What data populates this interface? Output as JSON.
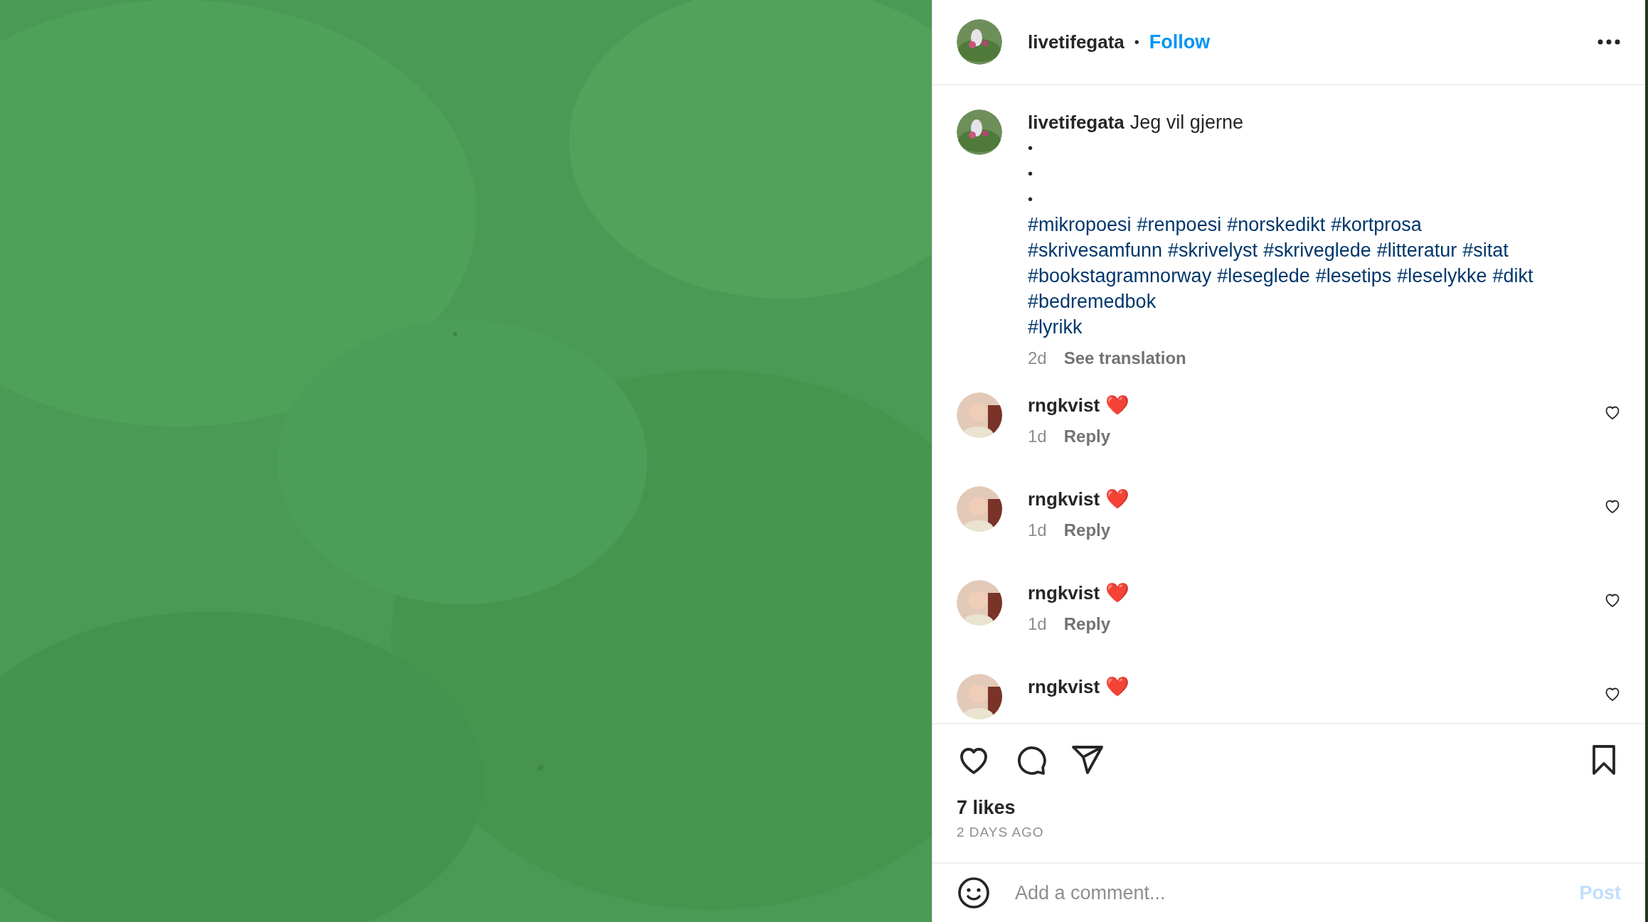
{
  "header": {
    "username": "livetifegata",
    "separator": "•",
    "follow": "Follow"
  },
  "caption": {
    "username": "livetifegata",
    "text": "Jeg vil gjerne",
    "bullets": [
      "•",
      "•",
      "•"
    ],
    "hashtag_lines": [
      [
        "#mikropoesi",
        "#renpoesi",
        "#norskedikt",
        "#kortprosa"
      ],
      [
        "#skrivesamfunn",
        "#skrivelyst",
        "#skriveglede",
        "#litteratur",
        "#sitat"
      ],
      [
        "#bookstagramnorway",
        "#leseglede",
        "#lesetips",
        "#leselykke",
        "#dikt"
      ],
      [
        "#bedremedbok"
      ],
      [
        "#lyrikk"
      ]
    ],
    "time": "2d",
    "translate": "See translation"
  },
  "comments": [
    {
      "username": "rngkvist",
      "text": "❤️",
      "time": "1d",
      "reply": "Reply",
      "liked": false
    },
    {
      "username": "rngkvist",
      "text": "❤️",
      "time": "1d",
      "reply": "Reply",
      "liked": false
    },
    {
      "username": "rngkvist",
      "text": "❤️",
      "time": "1d",
      "reply": "Reply",
      "liked": false
    },
    {
      "username": "rngkvist",
      "text": "❤️",
      "liked": false
    }
  ],
  "actions": {
    "liked": false,
    "saved": false
  },
  "likes": "7 likes",
  "date": "2 DAYS AGO",
  "add_comment": {
    "placeholder": "Add a comment...",
    "post": "Post",
    "disabled": true
  }
}
